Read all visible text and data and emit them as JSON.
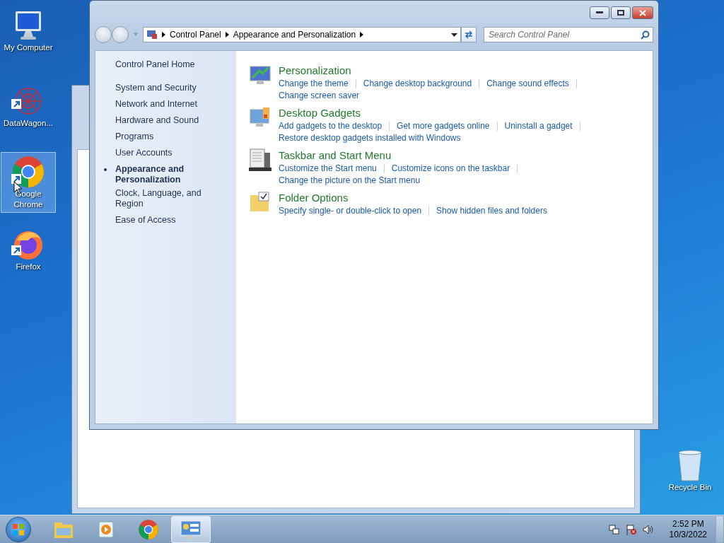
{
  "desktop_icons": [
    {
      "kind": "computer",
      "label": "My Computer",
      "selected": false
    },
    {
      "kind": "datawagon",
      "label": "DataWagon...",
      "selected": false
    },
    {
      "kind": "chrome",
      "label": "Google Chrome",
      "selected": true
    },
    {
      "kind": "firefox",
      "label": "Firefox",
      "selected": false
    }
  ],
  "recycle_bin": {
    "label": "Recycle Bin"
  },
  "window": {
    "breadcrumb": [
      "Control Panel",
      "Appearance and Personalization"
    ],
    "search": {
      "placeholder": "Search Control Panel"
    },
    "sidebar": {
      "home": "Control Panel Home",
      "items": [
        {
          "label": "System and Security",
          "selected": false
        },
        {
          "label": "Network and Internet",
          "selected": false
        },
        {
          "label": "Hardware and Sound",
          "selected": false
        },
        {
          "label": "Programs",
          "selected": false
        },
        {
          "label": "User Accounts",
          "selected": false
        },
        {
          "label": "Appearance and Personalization",
          "selected": true
        },
        {
          "label": "Clock, Language, and Region",
          "selected": false
        },
        {
          "label": "Ease of Access",
          "selected": false
        }
      ]
    },
    "categories": [
      {
        "kind": "personalization",
        "title": "Personalization",
        "links": [
          [
            "Change the theme",
            "Change desktop background",
            "Change sound effects"
          ],
          [
            "Change screen saver"
          ]
        ]
      },
      {
        "kind": "gadgets",
        "title": "Desktop Gadgets",
        "links": [
          [
            "Add gadgets to the desktop",
            "Get more gadgets online",
            "Uninstall a gadget"
          ],
          [
            "Restore desktop gadgets installed with Windows"
          ]
        ]
      },
      {
        "kind": "taskbar",
        "title": "Taskbar and Start Menu",
        "links": [
          [
            "Customize the Start menu",
            "Customize icons on the taskbar"
          ],
          [
            "Change the picture on the Start menu"
          ]
        ]
      },
      {
        "kind": "folder",
        "title": "Folder Options",
        "links": [
          [
            "Specify single- or double-click to open",
            "Show hidden files and folders"
          ]
        ]
      }
    ]
  },
  "taskbar": {
    "items": [
      {
        "kind": "explorer",
        "selected": false
      },
      {
        "kind": "media",
        "selected": false
      },
      {
        "kind": "chrome",
        "selected": false
      },
      {
        "kind": "control",
        "selected": true
      }
    ],
    "clock": {
      "time": "2:52 PM",
      "date": "10/3/2022"
    }
  }
}
